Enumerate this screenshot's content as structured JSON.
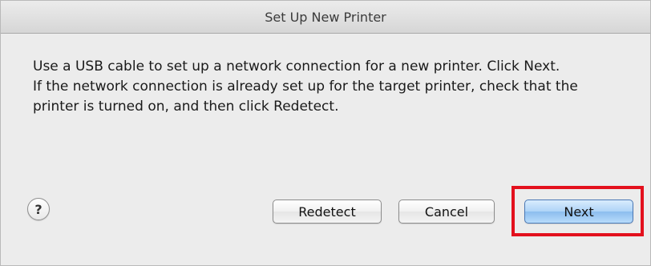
{
  "window": {
    "title": "Set Up New Printer"
  },
  "message": {
    "line1": "Use a USB cable to set up a network connection for a new printer. Click Next.",
    "line2": "If the network connection is already set up for the target printer, check that the printer is turned on, and then click Redetect."
  },
  "buttons": {
    "help_label": "?",
    "redetect_label": "Redetect",
    "cancel_label": "Cancel",
    "next_label": "Next"
  },
  "colors": {
    "highlight": "#e3101d",
    "default_button": "#aed3f7"
  }
}
